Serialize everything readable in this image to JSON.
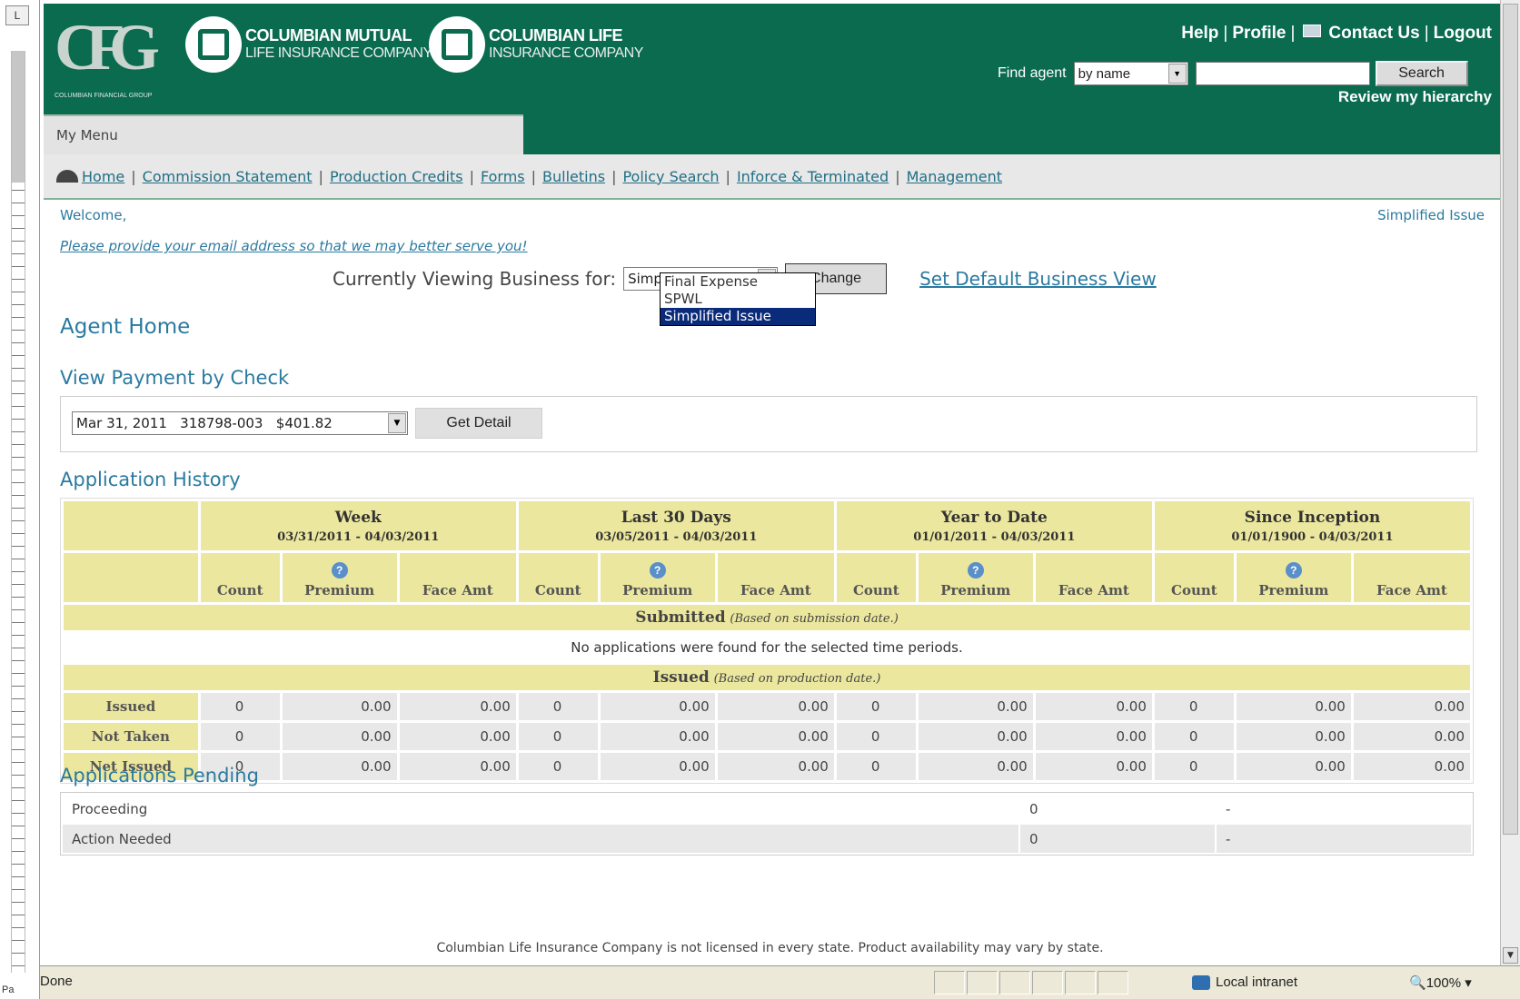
{
  "ruler": {
    "corner": "L",
    "bottom": "Pa"
  },
  "header": {
    "cfg_letters": "CFG",
    "cfg_sub": "COLUMBIAN FINANCIAL GROUP",
    "brand1_l1": "COLUMBIAN MUTUAL",
    "brand1_l2": "LIFE INSURANCE COMPANY",
    "brand2_l1": "COLUMBIAN LIFE",
    "brand2_l2": "INSURANCE COMPANY",
    "help": "Help",
    "profile": "Profile",
    "contact": "Contact Us",
    "logout": "Logout",
    "find_agent_label": "Find agent",
    "find_agent_select": "by name",
    "find_agent_value": "",
    "search_button": "Search",
    "review": "Review my hierarchy",
    "my_menu": "My Menu"
  },
  "nav": [
    "Home",
    "Commission Statement",
    "Production Credits",
    "Forms",
    "Bulletins",
    "Policy Search",
    "Inforce & Terminated",
    "Management"
  ],
  "content": {
    "welcome": "Welcome,",
    "top_right": "Simplified Issue",
    "email_prompt": "Please provide your email address so that we may better serve you!",
    "viewing_label": "Currently Viewing Business for:",
    "viewing_value": "Simplified Issue",
    "change_button": "Change",
    "set_default": "Set Default Business View",
    "dropdown_options": [
      "Final Expense",
      "SPWL",
      "Simplified Issue"
    ],
    "agent_home": "Agent Home",
    "payment_title": "View Payment by Check",
    "payment_select": "Mar 31, 2011   318798-003   $401.82",
    "get_detail": "Get Detail",
    "app_history_title": "Application History",
    "pending_title": "Applications Pending"
  },
  "history": {
    "periods": [
      {
        "title": "Week",
        "range": "03/31/2011 - 04/03/2011"
      },
      {
        "title": "Last 30 Days",
        "range": "03/05/2011 - 04/03/2011"
      },
      {
        "title": "Year to Date",
        "range": "01/01/2011 - 04/03/2011"
      },
      {
        "title": "Since Inception",
        "range": "01/01/1900 - 04/03/2011"
      }
    ],
    "cols": [
      "Count",
      "Premium",
      "Face Amt"
    ],
    "submitted_label": "Submitted",
    "submitted_note": "(Based on submission date.)",
    "no_apps": "No applications were found for the selected time periods.",
    "issued_label": "Issued",
    "issued_note": "(Based on production date.)",
    "rows": [
      {
        "label": "Issued",
        "values": [
          "0",
          "0.00",
          "0.00",
          "0",
          "0.00",
          "0.00",
          "0",
          "0.00",
          "0.00",
          "0",
          "0.00",
          "0.00"
        ]
      },
      {
        "label": "Not Taken",
        "values": [
          "0",
          "0.00",
          "0.00",
          "0",
          "0.00",
          "0.00",
          "0",
          "0.00",
          "0.00",
          "0",
          "0.00",
          "0.00"
        ]
      },
      {
        "label": "Net Issued",
        "values": [
          "0",
          "0.00",
          "0.00",
          "0",
          "0.00",
          "0.00",
          "0",
          "0.00",
          "0.00",
          "0",
          "0.00",
          "0.00"
        ]
      }
    ]
  },
  "pending": [
    {
      "label": "Proceeding",
      "count": "0",
      "extra": "-"
    },
    {
      "label": "Action Needed",
      "count": "0",
      "extra": "-"
    }
  ],
  "footer": "Columbian Life Insurance Company is not licensed in every state. Product availability may vary by state.",
  "status": {
    "done": "Done",
    "zone": "Local intranet",
    "zoom": "100%"
  }
}
